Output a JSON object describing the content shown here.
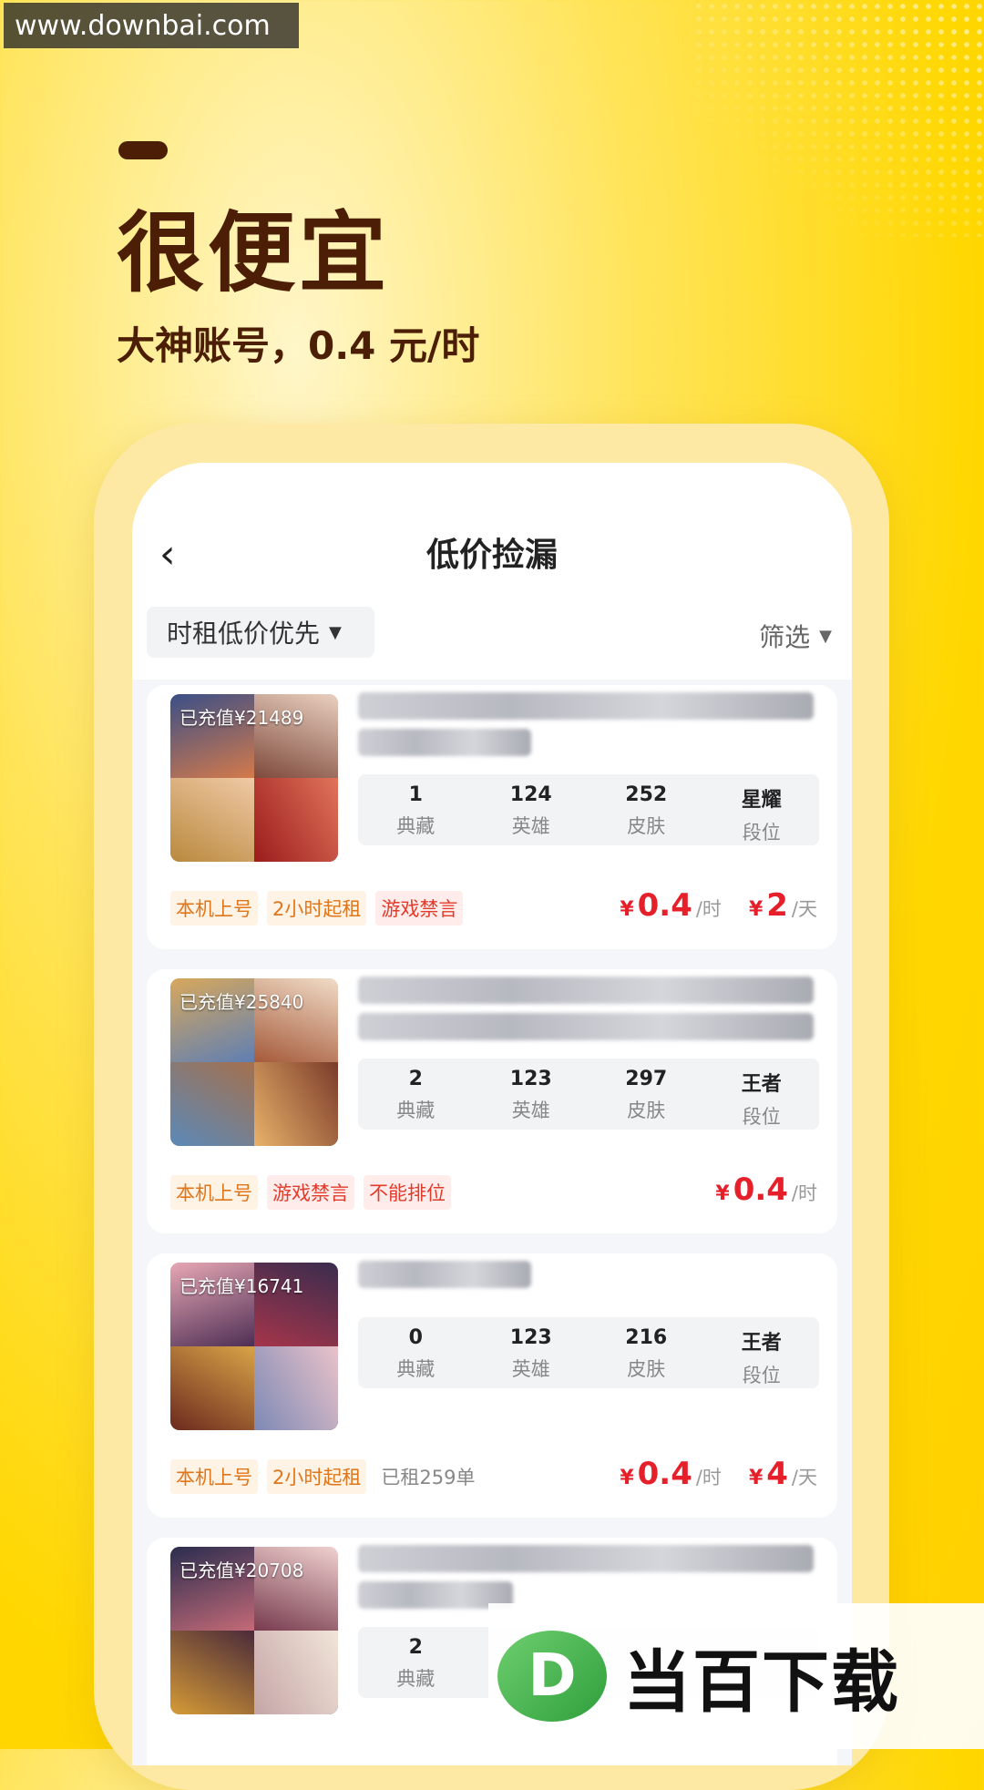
{
  "watermark_top": "www.downbai.com",
  "hero": {
    "title": "很便宜",
    "subtitle": "大神账号，0.4 元/时"
  },
  "nav": {
    "back_icon": "‹",
    "title": "低价捡漏"
  },
  "filters": {
    "sort_label": "时租低价优先",
    "filter_label": "筛选"
  },
  "listings": [
    {
      "recharge": "已充值¥21489",
      "stats": [
        {
          "value": "1",
          "label": "典藏"
        },
        {
          "value": "124",
          "label": "英雄"
        },
        {
          "value": "252",
          "label": "皮肤"
        },
        {
          "value": "星耀",
          "label": "段位"
        }
      ],
      "tags": [
        "本机上号",
        "2小时起租",
        "游戏禁言"
      ],
      "hour_price": "0.4",
      "hour_unit": "/时",
      "day_price": "2",
      "day_unit": "/天"
    },
    {
      "recharge": "已充值¥25840",
      "stats": [
        {
          "value": "2",
          "label": "典藏"
        },
        {
          "value": "123",
          "label": "英雄"
        },
        {
          "value": "297",
          "label": "皮肤"
        },
        {
          "value": "王者",
          "label": "段位"
        }
      ],
      "tags": [
        "本机上号",
        "游戏禁言",
        "不能排位"
      ],
      "hour_price": "0.4",
      "hour_unit": "/时"
    },
    {
      "recharge": "已充值¥16741",
      "stats": [
        {
          "value": "0",
          "label": "典藏"
        },
        {
          "value": "123",
          "label": "英雄"
        },
        {
          "value": "216",
          "label": "皮肤"
        },
        {
          "value": "王者",
          "label": "段位"
        }
      ],
      "tags": [
        "本机上号",
        "2小时起租"
      ],
      "rented": "已租259单",
      "hour_price": "0.4",
      "hour_unit": "/时",
      "day_price": "4",
      "day_unit": "/天"
    },
    {
      "recharge": "已充值¥20708",
      "stats": [
        {
          "value": "2",
          "label": "典藏"
        }
      ]
    }
  ],
  "currency_symbol": "¥",
  "watermark_logo": {
    "letter": "D",
    "text": "当百下载"
  }
}
